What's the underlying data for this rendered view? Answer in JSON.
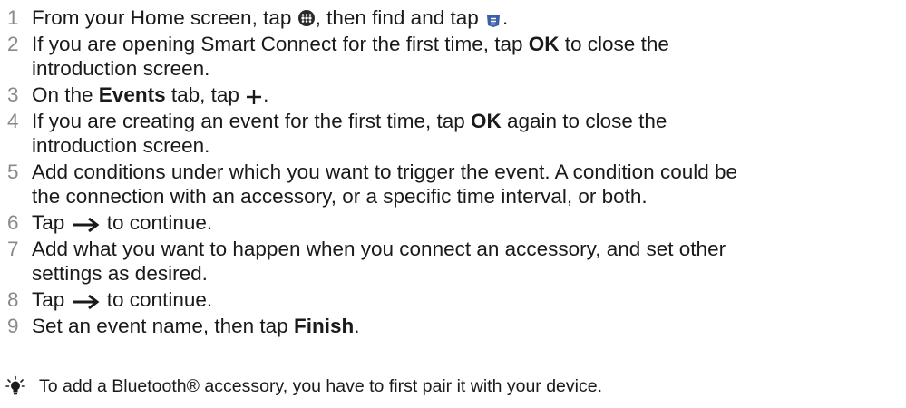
{
  "steps": [
    {
      "num": "1",
      "a": "From your Home screen, tap ",
      "b": ", then find and tap ",
      "c": ".",
      "icon1": "apps-icon",
      "icon2": "smart-connect-icon"
    },
    {
      "num": "2",
      "a": "If you are opening Smart Connect for the first time, tap ",
      "bold": "OK",
      "b": " to close the",
      "line2": "introduction screen."
    },
    {
      "num": "3",
      "a": "On the ",
      "bold": "Events",
      "b": " tab, tap ",
      "c": ".",
      "icon": "plus-icon"
    },
    {
      "num": "4",
      "a": "If you are creating an event for the first time, tap ",
      "bold": "OK",
      "b": " again to close the",
      "line2": "introduction screen."
    },
    {
      "num": "5",
      "a": "Add conditions under which you want to trigger the event. A condition could be",
      "line2": "the connection with an accessory, or a specific time interval, or both."
    },
    {
      "num": "6",
      "a": "Tap ",
      "b": " to continue.",
      "icon": "arrow-right-icon"
    },
    {
      "num": "7",
      "a": "Add what you want to happen when you connect an accessory, and set other",
      "line2": "settings as desired."
    },
    {
      "num": "8",
      "a": "Tap ",
      "b": " to continue.",
      "icon": "arrow-right-icon"
    },
    {
      "num": "9",
      "a": "Set an event name, then tap ",
      "bold": "Finish",
      "b": "."
    }
  ],
  "tip": {
    "icon": "lightbulb-tip-icon",
    "text": "To add a Bluetooth® accessory, you have to first pair it with your device."
  }
}
